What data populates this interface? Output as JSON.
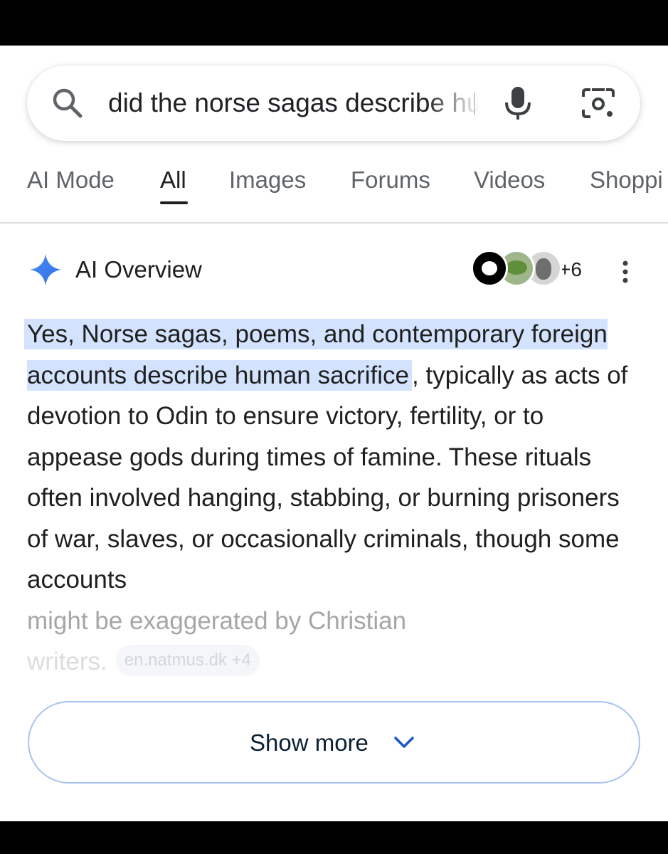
{
  "search": {
    "query": "did the norse sagas describe human sacrifice",
    "icon": "search-icon",
    "voice_icon": "mic-icon",
    "lens_icon": "lens-icon"
  },
  "tabs": [
    {
      "label": "AI Mode",
      "active": false
    },
    {
      "label": "All",
      "active": true
    },
    {
      "label": "Images",
      "active": false
    },
    {
      "label": "Forums",
      "active": false
    },
    {
      "label": "Videos",
      "active": false
    },
    {
      "label": "Shoppi",
      "active": false
    }
  ],
  "ai_overview": {
    "title": "AI Overview",
    "sources_more": "+6",
    "highlight_text": "Yes, Norse sagas, poems, and contemporary foreign accounts describe human sacrifice",
    "body_text": ", typically as acts of devotion to Odin to ensure victory, fertility, or to appease gods during times of famine. These rituals often involved hanging, stabbing, or burning prisoners of war, slaves, or occasionally criminals, though some accounts",
    "faded_text_1": "might be exaggerated by Christian",
    "faded_text_2": "writers.",
    "source_chip": "en.natmus.dk +4"
  },
  "show_more": {
    "label": "Show more"
  },
  "colors": {
    "highlight": "#d3e3fd",
    "sparkle": "#3b7ff6",
    "button_border": "#a8c2f2",
    "chevron": "#1a56c8"
  }
}
